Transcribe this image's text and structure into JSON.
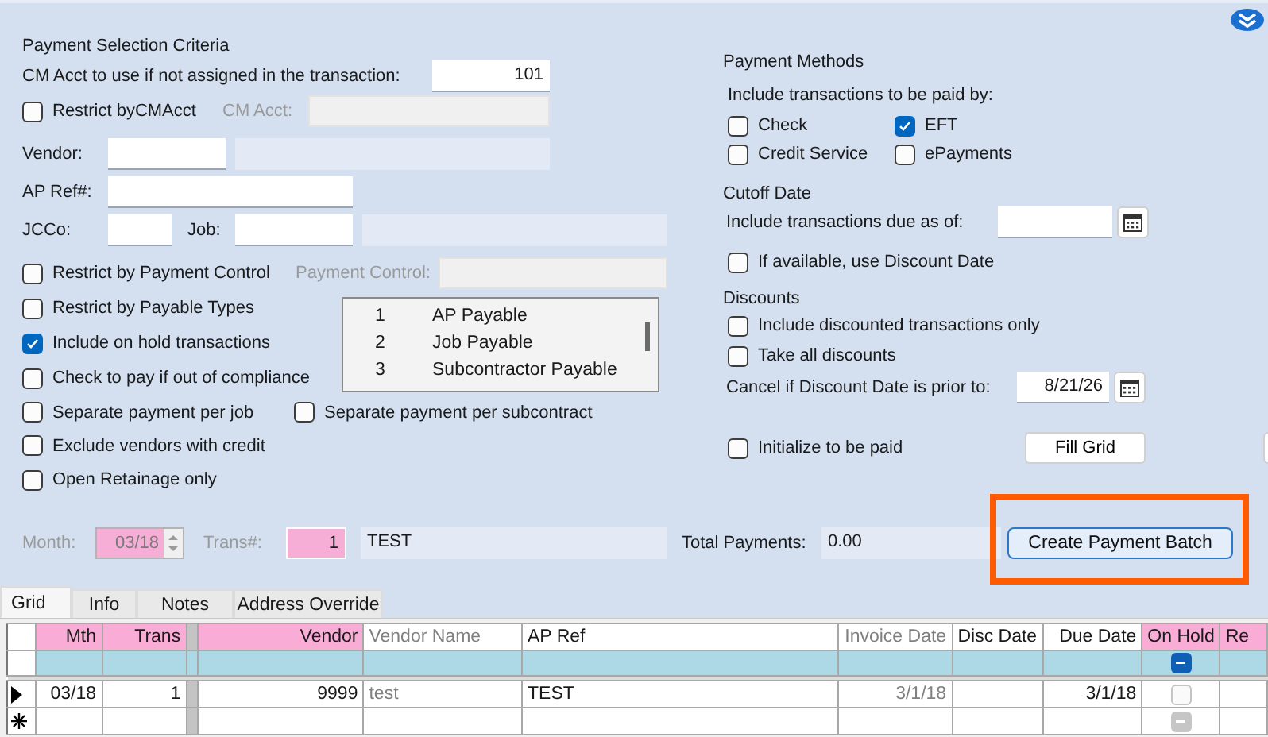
{
  "criteria": {
    "title": "Payment Selection Criteria",
    "cm_acct": {
      "label": "CM Acct to use if not assigned in the transaction:",
      "value": "101"
    },
    "restrict_cm_acct": {
      "label": "Restrict byCMAcct",
      "checked": false
    },
    "cm_acct_filter": {
      "label": "CM Acct:"
    },
    "vendor": {
      "label": "Vendor:"
    },
    "ap_ref": {
      "label": "AP Ref#:"
    },
    "jcco": {
      "label": "JCCo:"
    },
    "job": {
      "label": "Job:"
    },
    "restrict_payment_control": {
      "label": "Restrict by Payment Control",
      "checked": false
    },
    "payment_control": {
      "label": "Payment Control:"
    },
    "options": [
      {
        "label": "Restrict by Payable Types",
        "checked": false
      },
      {
        "label": "Include on hold transactions",
        "checked": true
      },
      {
        "label": "Check to pay if out of compliance",
        "checked": false
      },
      {
        "label": "Separate payment per job",
        "checked": false
      },
      {
        "label": "Separate payment per subcontract",
        "checked": false
      },
      {
        "label": "Exclude vendors with credit",
        "checked": false
      },
      {
        "label": "Open Retainage only",
        "checked": false
      }
    ],
    "payable_types": [
      {
        "code": "1",
        "name": "AP Payable"
      },
      {
        "code": "2",
        "name": "Job Payable"
      },
      {
        "code": "3",
        "name": "Subcontractor Payable"
      }
    ]
  },
  "methods": {
    "title": "Payment Methods",
    "prompt": "Include transactions to be paid by:",
    "options": [
      {
        "label": "Check",
        "checked": false
      },
      {
        "label": "EFT",
        "checked": true
      },
      {
        "label": "Credit Service",
        "checked": false
      },
      {
        "label": "ePayments",
        "checked": false
      }
    ]
  },
  "cutoff": {
    "title": "Cutoff Date",
    "due_label": "Include transactions due as of:",
    "use_discount_date": {
      "label": "If available, use Discount Date",
      "checked": false
    }
  },
  "discounts": {
    "title": "Discounts",
    "options": [
      {
        "label": "Include discounted transactions only",
        "checked": false
      },
      {
        "label": "Take all discounts",
        "checked": false
      }
    ],
    "cancel_label": "Cancel if Discount Date is prior to:",
    "cancel_date": "8/21/26"
  },
  "initialize": {
    "label": "Initialize to be paid",
    "checked": false
  },
  "fill_grid_button": "Fill Grid",
  "batch": {
    "month_label": "Month:",
    "month": "03/18",
    "trans_label": "Trans#:",
    "trans": "1",
    "description": "TEST",
    "total_label": "Total Payments:",
    "total": "0.00",
    "create_button": "Create Payment Batch"
  },
  "tabs": [
    {
      "label": "Grid",
      "selected": true
    },
    {
      "label": "Info",
      "selected": false
    },
    {
      "label": "Notes",
      "selected": false
    },
    {
      "label": "Address Override",
      "selected": false
    }
  ],
  "grid": {
    "columns": [
      {
        "label": "Mth",
        "kind": "key"
      },
      {
        "label": "Trans",
        "kind": "key"
      },
      {
        "label": "Vendor",
        "kind": "key"
      },
      {
        "label": "Vendor Name",
        "kind": "readonly"
      },
      {
        "label": "AP Ref",
        "kind": "plain"
      },
      {
        "label": "Invoice Date",
        "kind": "readonly"
      },
      {
        "label": "Disc Date",
        "kind": "plain"
      },
      {
        "label": "Due Date",
        "kind": "plain"
      },
      {
        "label": "On Hold",
        "kind": "key"
      },
      {
        "label": "Re",
        "kind": "key"
      }
    ],
    "filter_on_hold": {
      "indeterminate": true,
      "disabled": false
    },
    "rows": [
      {
        "current": true,
        "new": false,
        "mth": "03/18",
        "trans": "1",
        "vendor": "9999",
        "vendor_name": "test",
        "ap_ref": "TEST",
        "invoice_date": "3/1/18",
        "due_date": "3/1/18",
        "on_hold": {
          "indeterminate": false,
          "disabled": false
        }
      },
      {
        "current": false,
        "new": true,
        "on_hold": {
          "indeterminate": true,
          "disabled": true
        }
      }
    ]
  }
}
